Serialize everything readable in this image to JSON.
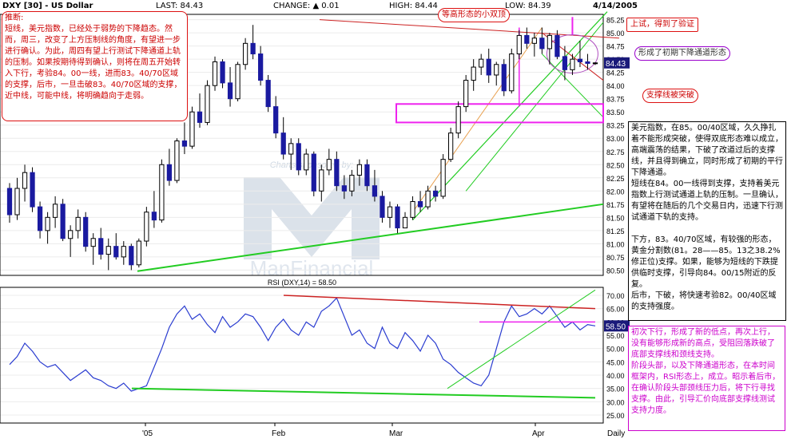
{
  "header": {
    "symbol": "DXY [30] - US Dollar",
    "last": "LAST: 84.43",
    "change": "CHANGE: ▲ 0.01",
    "high": "HIGH: 84.44",
    "low": "LOW: 84.39",
    "date": "4/14/2005"
  },
  "watermark": {
    "sponsor": "Charts sponsored by:",
    "brand": "ManFinancial"
  },
  "price_panel": {
    "y_ticks": [
      "85.25",
      "85.00",
      "84.75",
      "84.50",
      "84.25",
      "84.00",
      "83.75",
      "83.50",
      "83.25",
      "83.00",
      "82.75",
      "82.50",
      "82.25",
      "82.00",
      "81.75",
      "81.50",
      "81.25",
      "81.00",
      "80.75",
      "80.50"
    ],
    "last_label": "84.43"
  },
  "rsi_panel": {
    "title": "RSI (DXY,14) = 58.50",
    "y_ticks": [
      "70.00",
      "65.00",
      "60.00",
      "55.00",
      "50.00",
      "45.00",
      "40.00",
      "35.00",
      "30.00",
      "25.00"
    ],
    "last_label": "58.50"
  },
  "x_axis": {
    "labels": [
      "'05",
      "Feb",
      "Mar",
      "Apr",
      "Daily"
    ]
  },
  "annotations": {
    "left_box": "推断:\n短线，美元指数，已经处于弱势的下降趋态。然而，周三，改变了上方压制线的角度，有望进一步进行确认。为此，周四有望上行测试下降通道上轨的压制。如果按期待得到确认，则将在周五开始转入下行，考验84。00一线，进而83。40/70区域的支撑，后市，一旦击破83。40/70区域的支撑，近中线，可能中线，将明确趋向于走弱。",
    "double_top": "等高形态的小双顶",
    "verified": "上试，得到了验证",
    "channel": "形成了初期下降通道形态",
    "support_break": "支撑线被突破",
    "right_box": "美元指数，在85。00/40区域，久久挣扎着不能形成突破，使得双底形态难以成立，高端震荡的结果，下破了改道过后的支撑线，并且得到确立，同时形成了初期的平行下降通道。\n短线在84。00一线得到支撑，支持着美元指数上行测试通道上轨的压制。一旦确认，有望将在随后的几个交易日内，迅速下行测试通道下轨的支持。\n\n下方，83。40/70区域，有较强的形态，黄金分割数(81。28——85。13之38.2%修正位)支撑。如果，能够为短线的下跌提供临时支撑，引导向84。00/15附近的反复。\n后市，下破，将快速考验82。00/40区域的支持强度。",
    "rsi_box": "初次下行，形成了新的低点，再次上行，没有能够形成新的高点，受阻回落跌破了底部支撑线和颈线支持。\n阶段头部，以及下降通道形态，在本时间框架内，RSI形态上，成立。昭示着后市，在确认阶段头部颈线压力后，将下行寻找支撑。由此，引导汇价向底部支撑线测试支持力度。"
  },
  "colors": {
    "up": "#ffffff",
    "down": "#1a1aa0",
    "trend_green": "#22cc22",
    "resist_red": "#cc2222",
    "neck_magenta": "#ee22ee",
    "fib": "#e8a050"
  },
  "chart_data": [
    {
      "type": "candlestick",
      "title": "DXY [30] - US Dollar",
      "y_range": [
        80.4,
        85.35
      ],
      "series": [
        {
          "name": "DXY",
          "ohlc": [
            [
              82.05,
              82.15,
              81.4,
              81.55
            ],
            [
              81.55,
              82.25,
              81.45,
              82.05
            ],
            [
              82.05,
              82.5,
              81.8,
              82.35
            ],
            [
              82.35,
              82.45,
              81.6,
              81.7
            ],
            [
              81.7,
              81.8,
              81.1,
              81.25
            ],
            [
              81.25,
              81.6,
              81.0,
              81.5
            ],
            [
              81.5,
              81.9,
              81.3,
              81.75
            ],
            [
              81.75,
              81.85,
              81.05,
              81.1
            ],
            [
              81.1,
              81.35,
              80.75,
              81.25
            ],
            [
              81.25,
              81.65,
              81.1,
              81.5
            ],
            [
              81.5,
              81.6,
              80.85,
              80.95
            ],
            [
              80.95,
              81.2,
              80.6,
              81.1
            ],
            [
              81.1,
              81.3,
              80.7,
              80.8
            ],
            [
              80.8,
              81.1,
              80.5,
              80.95
            ],
            [
              80.95,
              81.2,
              80.7,
              80.75
            ],
            [
              80.75,
              81.05,
              80.6,
              80.95
            ],
            [
              80.95,
              81.0,
              80.5,
              80.6
            ],
            [
              80.6,
              81.1,
              80.55,
              81.05
            ],
            [
              81.05,
              81.7,
              80.95,
              81.6
            ],
            [
              81.6,
              82.0,
              81.3,
              81.45
            ],
            [
              81.45,
              82.6,
              81.4,
              82.5
            ],
            [
              82.5,
              82.8,
              82.1,
              82.2
            ],
            [
              82.2,
              83.0,
              82.15,
              82.95
            ],
            [
              82.95,
              83.3,
              82.7,
              82.85
            ],
            [
              82.85,
              83.6,
              82.8,
              83.5
            ],
            [
              83.5,
              83.85,
              83.2,
              83.3
            ],
            [
              83.3,
              84.1,
              83.25,
              84.0
            ],
            [
              84.0,
              84.55,
              83.9,
              84.45
            ],
            [
              84.45,
              84.5,
              83.95,
              84.05
            ],
            [
              84.05,
              84.35,
              83.6,
              83.75
            ],
            [
              83.75,
              84.45,
              83.7,
              84.4
            ],
            [
              84.4,
              84.9,
              84.3,
              84.8
            ],
            [
              84.8,
              85.15,
              84.5,
              84.6
            ],
            [
              84.6,
              84.75,
              84.0,
              84.1
            ],
            [
              84.1,
              84.2,
              83.5,
              83.6
            ],
            [
              83.6,
              83.8,
              83.0,
              83.1
            ],
            [
              83.1,
              83.4,
              82.6,
              82.7
            ],
            [
              82.7,
              83.0,
              82.4,
              82.9
            ],
            [
              82.9,
              83.0,
              82.3,
              82.4
            ],
            [
              82.4,
              82.8,
              82.3,
              82.7
            ],
            [
              82.7,
              82.75,
              81.9,
              82.0
            ],
            [
              82.0,
              82.5,
              81.8,
              82.4
            ],
            [
              82.4,
              82.8,
              82.3,
              82.6
            ],
            [
              82.6,
              82.75,
              82.0,
              82.1
            ],
            [
              82.1,
              82.3,
              81.85,
              82.0
            ],
            [
              82.0,
              82.4,
              81.9,
              82.3
            ],
            [
              82.3,
              82.6,
              82.1,
              82.5
            ],
            [
              82.5,
              82.6,
              82.0,
              82.1
            ],
            [
              82.1,
              82.4,
              81.8,
              81.9
            ],
            [
              81.9,
              82.0,
              81.4,
              81.5
            ],
            [
              81.5,
              81.8,
              81.3,
              81.7
            ],
            [
              81.7,
              81.75,
              81.2,
              81.3
            ],
            [
              81.3,
              81.6,
              81.3,
              81.5
            ],
            [
              81.5,
              81.9,
              81.45,
              81.8
            ],
            [
              81.8,
              82.0,
              81.6,
              81.7
            ],
            [
              81.7,
              82.1,
              81.65,
              82.0
            ],
            [
              82.0,
              82.1,
              81.8,
              81.9
            ],
            [
              81.9,
              82.7,
              81.85,
              82.6
            ],
            [
              82.6,
              83.2,
              82.55,
              83.1
            ],
            [
              83.1,
              83.7,
              83.0,
              83.6
            ],
            [
              83.6,
              84.2,
              83.5,
              84.1
            ],
            [
              84.1,
              84.5,
              83.9,
              84.35
            ],
            [
              84.35,
              84.6,
              84.2,
              84.5
            ],
            [
              84.5,
              84.7,
              84.05,
              84.2
            ],
            [
              84.2,
              84.45,
              84.0,
              84.4
            ],
            [
              84.4,
              84.5,
              83.8,
              83.9
            ],
            [
              83.9,
              84.7,
              83.85,
              84.6
            ],
            [
              84.6,
              85.05,
              84.5,
              84.95
            ],
            [
              84.95,
              85.1,
              84.7,
              84.8
            ],
            [
              84.8,
              85.0,
              84.55,
              84.9
            ],
            [
              84.9,
              85.1,
              84.6,
              84.7
            ],
            [
              84.7,
              85.0,
              84.4,
              84.95
            ],
            [
              84.95,
              85.05,
              84.5,
              84.55
            ],
            [
              84.55,
              84.75,
              84.1,
              84.3
            ],
            [
              84.3,
              84.6,
              84.2,
              84.5
            ],
            [
              84.5,
              84.85,
              84.35,
              84.45
            ],
            [
              84.45,
              84.6,
              84.3,
              84.42
            ],
            [
              84.42,
              84.44,
              84.39,
              84.43
            ]
          ]
        }
      ]
    },
    {
      "type": "line",
      "title": "RSI (DXY,14) = 58.50",
      "y_range": [
        22,
        73
      ],
      "series": [
        {
          "name": "RSI (DXY,14)",
          "values": [
            44,
            47,
            52,
            49,
            45,
            43,
            44,
            41,
            38,
            40,
            42,
            39,
            38,
            36,
            35,
            37,
            34,
            35,
            36,
            43,
            50,
            58,
            63,
            66,
            61,
            63,
            59,
            56,
            62,
            58,
            60,
            63,
            62,
            58,
            53,
            58,
            61,
            57,
            55,
            60,
            58,
            64,
            66,
            69,
            62,
            55,
            57,
            52,
            50,
            58,
            52,
            50,
            56,
            53,
            49,
            55,
            52,
            46,
            44,
            41,
            39,
            37,
            36,
            40,
            50,
            60,
            66,
            62,
            63,
            65,
            63,
            66,
            62,
            58,
            60,
            57,
            59,
            58.5
          ]
        }
      ]
    }
  ]
}
